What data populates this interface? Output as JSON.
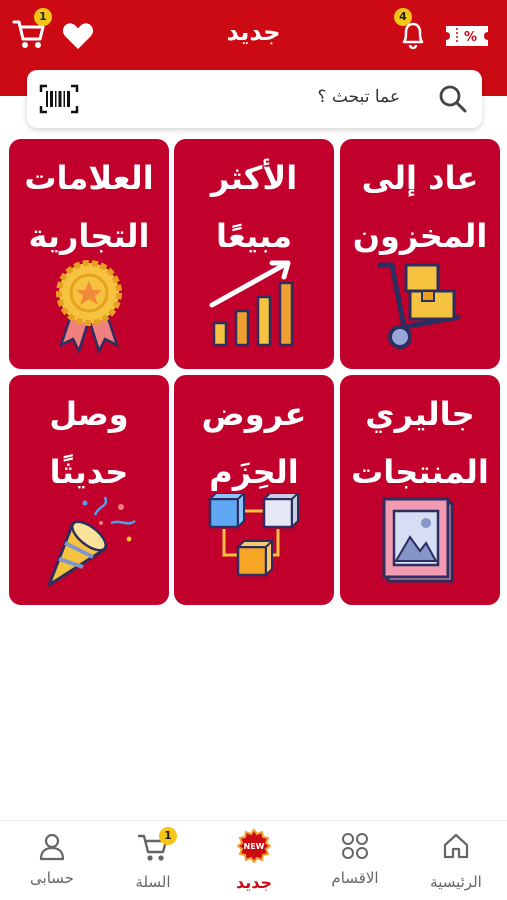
{
  "header": {
    "title": "جديد",
    "cart_badge": "1",
    "notifications_badge": "4",
    "brand_color": "#cc0a14"
  },
  "search": {
    "placeholder": "عما تبحث ؟"
  },
  "tiles": [
    {
      "line1": "عاد إلى",
      "line2": "المخزون",
      "icon": "hand-truck-icon"
    },
    {
      "line1": "الأكثر",
      "line2": "مبيعًا",
      "icon": "bar-chart-growth-icon"
    },
    {
      "line1": "العلامات",
      "line2": "التجارية",
      "icon": "award-badge-icon"
    },
    {
      "line1": "جاليري",
      "line2": "المنتجات",
      "icon": "picture-frame-icon"
    },
    {
      "line1": "عروض",
      "line2": "الحِزَم",
      "icon": "connected-cubes-icon"
    },
    {
      "line1": "وصل",
      "line2": "حديثًا",
      "icon": "party-popper-icon"
    }
  ],
  "tile_color": "#c1002b",
  "bottom_nav": {
    "items": [
      {
        "label": "الرئيسية",
        "icon": "home-icon"
      },
      {
        "label": "الاقسام",
        "icon": "grid-icon"
      },
      {
        "label": "جديد",
        "icon": "new-badge-icon",
        "active": true
      },
      {
        "label": "السلة",
        "icon": "cart-icon",
        "badge": "1"
      },
      {
        "label": "حسابى",
        "icon": "user-icon"
      }
    ],
    "new_badge_text": "NEW"
  }
}
